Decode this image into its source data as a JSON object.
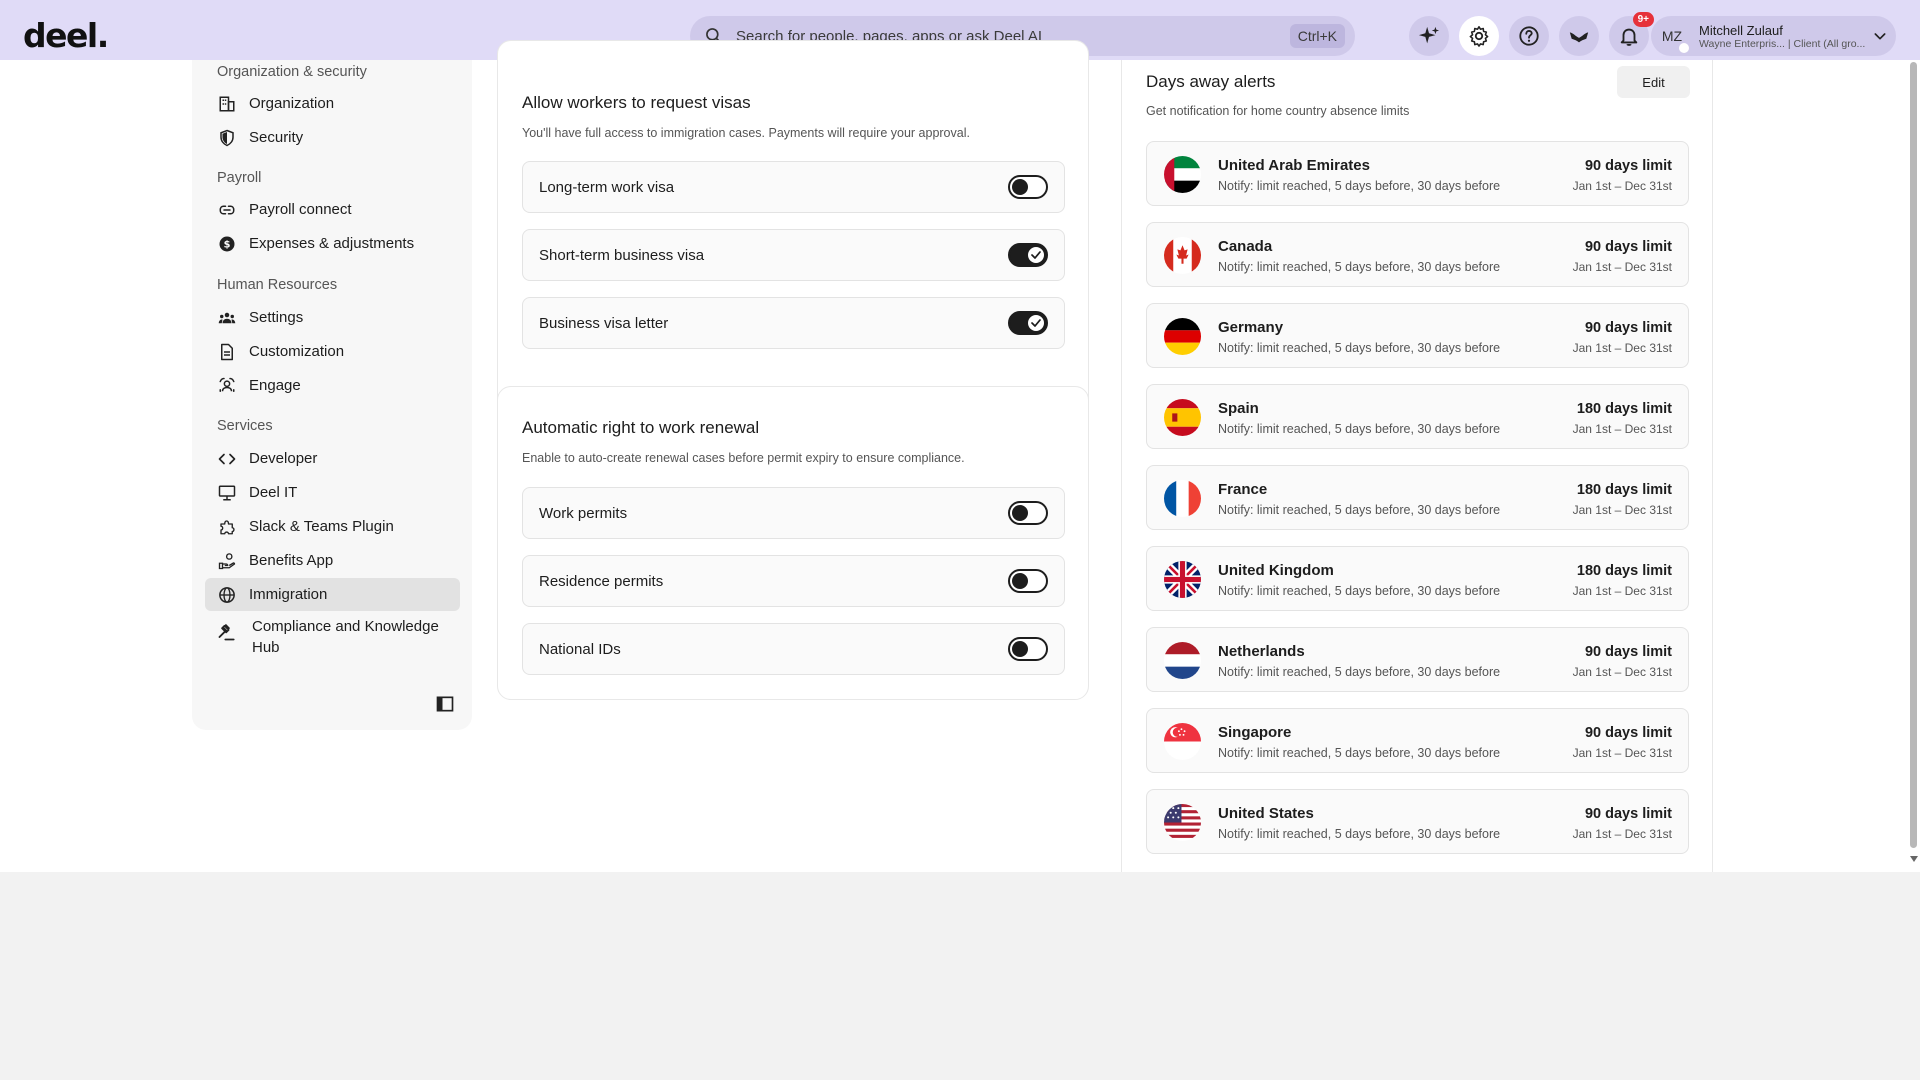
{
  "header": {
    "logo": "deel.",
    "search_placeholder": "Search for people, pages, apps or ask Deel AI",
    "search_shortcut": "Ctrl+K",
    "notification_badge": "9+",
    "user": {
      "initials": "MZ",
      "name": "Mitchell Zulauf",
      "subtitle": "Wayne Enterpris... | Client (All gro..."
    }
  },
  "sidebar": {
    "sections": [
      {
        "title": "Organization & security",
        "items": [
          "Organization",
          "Security"
        ]
      },
      {
        "title": "Payroll",
        "items": [
          "Payroll connect",
          "Expenses & adjustments"
        ]
      },
      {
        "title": "Human Resources",
        "items": [
          "Settings",
          "Customization",
          "Engage"
        ]
      },
      {
        "title": "Services",
        "items": [
          "Developer",
          "Deel IT",
          "Slack & Teams Plugin",
          "Benefits App",
          "Immigration",
          "Compliance and Knowledge Hub"
        ]
      }
    ],
    "active_item": "Immigration"
  },
  "visa_card": {
    "title": "Allow workers to request visas",
    "description": "You'll have full access to immigration cases. Payments will require your approval.",
    "toggles": [
      {
        "label": "Long-term work visa",
        "on": false
      },
      {
        "label": "Short-term business visa",
        "on": true
      },
      {
        "label": "Business visa letter",
        "on": true
      }
    ]
  },
  "renewal_card": {
    "title": "Automatic right to work renewal",
    "description": "Enable to auto-create renewal cases before permit expiry to ensure compliance.",
    "toggles": [
      {
        "label": "Work permits",
        "on": false
      },
      {
        "label": "Residence permits",
        "on": false
      },
      {
        "label": "National IDs",
        "on": false
      }
    ]
  },
  "alerts": {
    "title": "Days away alerts",
    "description": "Get notification for home country absence limits",
    "edit_label": "Edit",
    "countries": [
      {
        "name": "United Arab Emirates",
        "notify": "Notify: limit reached, 5 days before, 30 days before",
        "limit": "90 days limit",
        "period": "Jan 1st – Dec 31st",
        "flag": "ae"
      },
      {
        "name": "Canada",
        "notify": "Notify: limit reached, 5 days before, 30 days before",
        "limit": "90 days limit",
        "period": "Jan 1st – Dec 31st",
        "flag": "ca"
      },
      {
        "name": "Germany",
        "notify": "Notify: limit reached, 5 days before, 30 days before",
        "limit": "90 days limit",
        "period": "Jan 1st – Dec 31st",
        "flag": "de"
      },
      {
        "name": "Spain",
        "notify": "Notify: limit reached, 5 days before, 30 days before",
        "limit": "180 days limit",
        "period": "Jan 1st – Dec 31st",
        "flag": "es"
      },
      {
        "name": "France",
        "notify": "Notify: limit reached, 5 days before, 30 days before",
        "limit": "180 days limit",
        "period": "Jan 1st – Dec 31st",
        "flag": "fr"
      },
      {
        "name": "United Kingdom",
        "notify": "Notify: limit reached, 5 days before, 30 days before",
        "limit": "180 days limit",
        "period": "Jan 1st – Dec 31st",
        "flag": "gb"
      },
      {
        "name": "Netherlands",
        "notify": "Notify: limit reached, 5 days before, 30 days before",
        "limit": "90 days limit",
        "period": "Jan 1st – Dec 31st",
        "flag": "nl"
      },
      {
        "name": "Singapore",
        "notify": "Notify: limit reached, 5 days before, 30 days before",
        "limit": "90 days limit",
        "period": "Jan 1st – Dec 31st",
        "flag": "sg"
      },
      {
        "name": "United States",
        "notify": "Notify: limit reached, 5 days before, 30 days before",
        "limit": "90 days limit",
        "period": "Jan 1st – Dec 31st",
        "flag": "us"
      }
    ]
  },
  "colors": {
    "header_bg": "#e0dbf7",
    "accent_dark": "#1d1d1d",
    "notification_red": "#e6313a"
  }
}
